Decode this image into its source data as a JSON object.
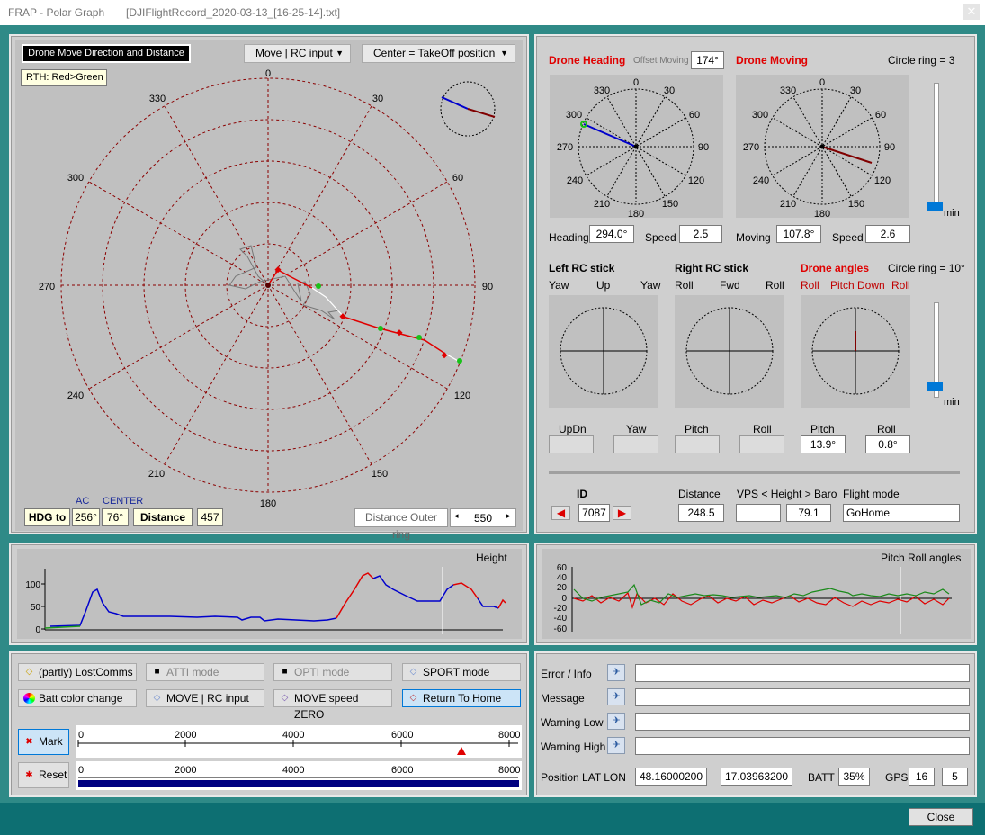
{
  "titlebar": {
    "app": "FRAP  -  Polar Graph",
    "file": "[DJIFlightRecord_2020-03-13_[16-25-14].txt]",
    "close_glyph": "✕"
  },
  "polar": {
    "title_label": "Drone Move Direction and Distance",
    "rth_label": "RTH: Red>Green",
    "move_dropdown": "Move | RC input",
    "center_dropdown": "Center = TakeOff position",
    "angles": [
      "0",
      "30",
      "60",
      "90",
      "120",
      "150",
      "180",
      "210",
      "240",
      "270",
      "300",
      "330"
    ],
    "hdg_to_label": "HDG to",
    "ac_label": "AC",
    "center_label": "CENTER",
    "ac_value": "256°",
    "center_value": "76°",
    "distance_label": "Distance",
    "distance_value": "457",
    "outer_ring_label": "Distance Outer ring",
    "outer_ring_value": "550"
  },
  "heading_panel": {
    "drone_heading": "Drone Heading",
    "offset_label": "Offset Moving",
    "offset_value": "174°",
    "drone_moving": "Drone Moving",
    "circle_ring": "Circle ring = 3",
    "heading_label": "Heading",
    "heading_value": "294.0°",
    "speed_label": "Speed",
    "speed_value": "2.5",
    "moving_label": "Moving",
    "moving_value": "107.8°",
    "speed2_value": "2.6",
    "min_label": "min",
    "compass_labels": [
      "0",
      "30",
      "60",
      "90",
      "120",
      "150",
      "180",
      "210",
      "240",
      "270",
      "300",
      "330"
    ]
  },
  "rc_panel": {
    "left_title": "Left RC stick",
    "right_title": "Right RC stick",
    "angles_title": "Drone angles",
    "circle_ring": "Circle ring = 10°",
    "left_labels": [
      "Yaw",
      "Up",
      "Yaw"
    ],
    "right_labels": [
      "Roll",
      "Fwd",
      "Roll"
    ],
    "angle_labels": [
      "Roll",
      "Pitch Down",
      "Roll"
    ],
    "bottom_labels": [
      "UpDn",
      "Yaw",
      "Pitch",
      "Roll",
      "Pitch",
      "Roll"
    ],
    "pitch_value": "13.9°",
    "roll_value": "0.8°",
    "min_label": "min",
    "id_label": "ID",
    "id_value": "7087",
    "dist_label": "Distance",
    "dist_value": "248.5",
    "vps_label": "VPS < Height > Baro",
    "baro_value": "79.1",
    "mode_label": "Flight mode",
    "mode_value": "GoHome"
  },
  "height_chart": {
    "title": "Height",
    "yticks": [
      "100",
      "50",
      "0"
    ]
  },
  "pitchroll_chart": {
    "title": "Pitch Roll angles",
    "yticks": [
      "60",
      "40",
      "20",
      "0",
      "-20",
      "-40",
      "-60"
    ]
  },
  "mode_buttons": {
    "lostcomms": "(partly) LostComms",
    "atti": "ATTI mode",
    "opti": "OPTI mode",
    "sport": "SPORT mode",
    "batt": "Batt color change",
    "move_rc": "MOVE | RC input",
    "move_zero": "MOVE speed ZERO",
    "rth": "Return To Home",
    "mark": "Mark",
    "reset": "Reset",
    "ruler_ticks": [
      "0",
      "2000",
      "4000",
      "6000",
      "8000"
    ]
  },
  "info_panel": {
    "error_label": "Error / Info",
    "message_label": "Message",
    "warn_low_label": "Warning Low",
    "warn_high_label": "Warning High",
    "pos_label": "Position LAT LON",
    "lat": "48.16000200",
    "lon": "17.03963200",
    "batt_label": "BATT",
    "batt_value": "35%",
    "gps_label": "GPS",
    "gps1": "16",
    "gps2": "5"
  },
  "footer": {
    "close_label": "Close"
  }
}
